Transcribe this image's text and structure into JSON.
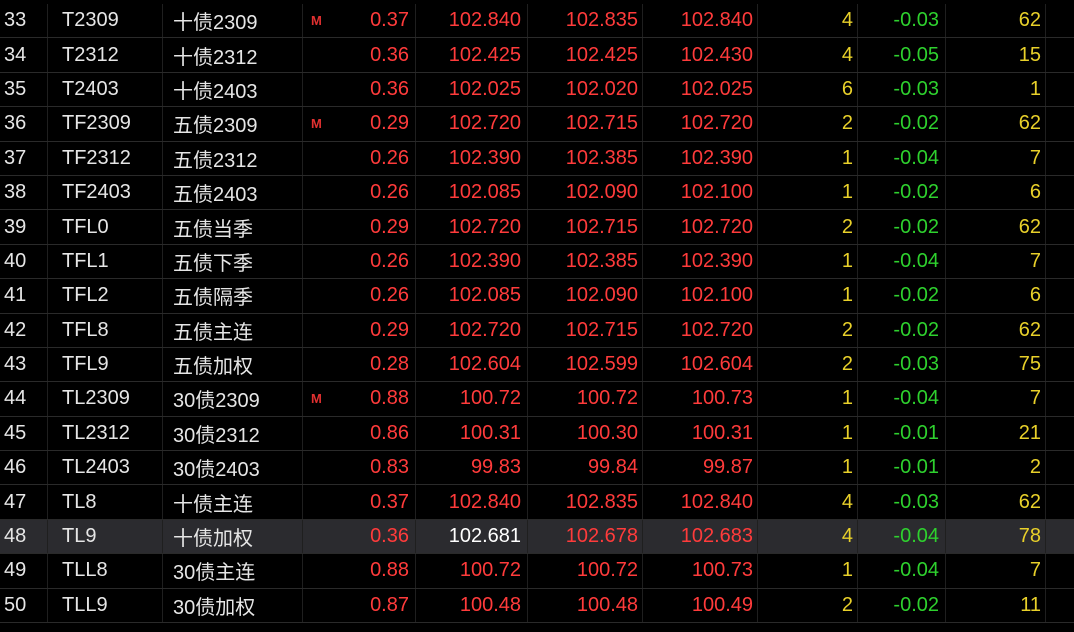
{
  "selected_index": "48",
  "rows": [
    {
      "idx": "33",
      "code": "T2309",
      "name": "十债2309",
      "flag": "M",
      "chg": "0.37",
      "last": "102.840",
      "bid": "102.835",
      "ask": "102.840",
      "vol": "4",
      "diff": "-0.03",
      "oi": "62"
    },
    {
      "idx": "34",
      "code": "T2312",
      "name": "十债2312",
      "flag": "",
      "chg": "0.36",
      "last": "102.425",
      "bid": "102.425",
      "ask": "102.430",
      "vol": "4",
      "diff": "-0.05",
      "oi": "15"
    },
    {
      "idx": "35",
      "code": "T2403",
      "name": "十债2403",
      "flag": "",
      "chg": "0.36",
      "last": "102.025",
      "bid": "102.020",
      "ask": "102.025",
      "vol": "6",
      "diff": "-0.03",
      "oi": "1"
    },
    {
      "idx": "36",
      "code": "TF2309",
      "name": "五债2309",
      "flag": "M",
      "chg": "0.29",
      "last": "102.720",
      "bid": "102.715",
      "ask": "102.720",
      "vol": "2",
      "diff": "-0.02",
      "oi": "62"
    },
    {
      "idx": "37",
      "code": "TF2312",
      "name": "五债2312",
      "flag": "",
      "chg": "0.26",
      "last": "102.390",
      "bid": "102.385",
      "ask": "102.390",
      "vol": "1",
      "diff": "-0.04",
      "oi": "7"
    },
    {
      "idx": "38",
      "code": "TF2403",
      "name": "五债2403",
      "flag": "",
      "chg": "0.26",
      "last": "102.085",
      "bid": "102.090",
      "ask": "102.100",
      "vol": "1",
      "diff": "-0.02",
      "oi": "6"
    },
    {
      "idx": "39",
      "code": "TFL0",
      "name": "五债当季",
      "flag": "",
      "chg": "0.29",
      "last": "102.720",
      "bid": "102.715",
      "ask": "102.720",
      "vol": "2",
      "diff": "-0.02",
      "oi": "62"
    },
    {
      "idx": "40",
      "code": "TFL1",
      "name": "五债下季",
      "flag": "",
      "chg": "0.26",
      "last": "102.390",
      "bid": "102.385",
      "ask": "102.390",
      "vol": "1",
      "diff": "-0.04",
      "oi": "7"
    },
    {
      "idx": "41",
      "code": "TFL2",
      "name": "五债隔季",
      "flag": "",
      "chg": "0.26",
      "last": "102.085",
      "bid": "102.090",
      "ask": "102.100",
      "vol": "1",
      "diff": "-0.02",
      "oi": "6"
    },
    {
      "idx": "42",
      "code": "TFL8",
      "name": "五债主连",
      "flag": "",
      "chg": "0.29",
      "last": "102.720",
      "bid": "102.715",
      "ask": "102.720",
      "vol": "2",
      "diff": "-0.02",
      "oi": "62"
    },
    {
      "idx": "43",
      "code": "TFL9",
      "name": "五债加权",
      "flag": "",
      "chg": "0.28",
      "last": "102.604",
      "bid": "102.599",
      "ask": "102.604",
      "vol": "2",
      "diff": "-0.03",
      "oi": "75"
    },
    {
      "idx": "44",
      "code": "TL2309",
      "name": "30债2309",
      "flag": "M",
      "chg": "0.88",
      "last": "100.72",
      "bid": "100.72",
      "ask": "100.73",
      "vol": "1",
      "diff": "-0.04",
      "oi": "7"
    },
    {
      "idx": "45",
      "code": "TL2312",
      "name": "30债2312",
      "flag": "",
      "chg": "0.86",
      "last": "100.31",
      "bid": "100.30",
      "ask": "100.31",
      "vol": "1",
      "diff": "-0.01",
      "oi": "21"
    },
    {
      "idx": "46",
      "code": "TL2403",
      "name": "30债2403",
      "flag": "",
      "chg": "0.83",
      "last": "99.83",
      "bid": "99.84",
      "ask": "99.87",
      "vol": "1",
      "diff": "-0.01",
      "oi": "2"
    },
    {
      "idx": "47",
      "code": "TL8",
      "name": "十债主连",
      "flag": "",
      "chg": "0.37",
      "last": "102.840",
      "bid": "102.835",
      "ask": "102.840",
      "vol": "4",
      "diff": "-0.03",
      "oi": "62"
    },
    {
      "idx": "48",
      "code": "TL9",
      "name": "十债加权",
      "flag": "",
      "chg": "0.36",
      "last": "102.681",
      "bid": "102.678",
      "ask": "102.683",
      "vol": "4",
      "diff": "-0.04",
      "oi": "78"
    },
    {
      "idx": "49",
      "code": "TLL8",
      "name": "30债主连",
      "flag": "",
      "chg": "0.88",
      "last": "100.72",
      "bid": "100.72",
      "ask": "100.73",
      "vol": "1",
      "diff": "-0.04",
      "oi": "7"
    },
    {
      "idx": "50",
      "code": "TLL9",
      "name": "30债加权",
      "flag": "",
      "chg": "0.87",
      "last": "100.48",
      "bid": "100.48",
      "ask": "100.49",
      "vol": "2",
      "diff": "-0.02",
      "oi": "11"
    }
  ]
}
